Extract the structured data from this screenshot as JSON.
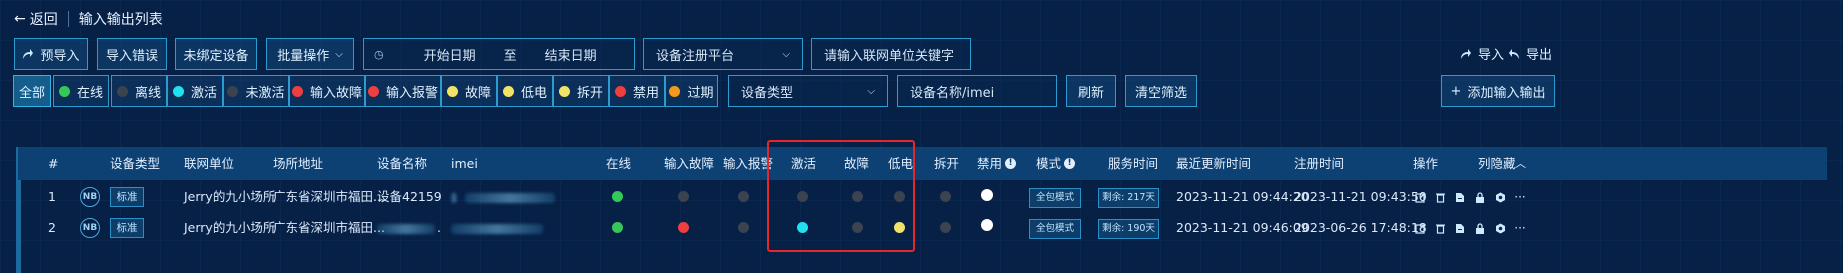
{
  "header": {
    "back_label": "返回",
    "title": "输入输出列表"
  },
  "toolbar": {
    "pre_import": "预导入",
    "import_error": "导入错误",
    "unbound_device": "未绑定设备",
    "batch_ops": "批量操作",
    "start_date": "开始日期",
    "date_to": "至",
    "end_date": "结束日期",
    "platform_select": "设备注册平台",
    "keyword_placeholder": "请输入联网单位关键字",
    "import": "导入",
    "export": "导出"
  },
  "filters": [
    {
      "label": "全部",
      "dot": null,
      "active": true
    },
    {
      "label": "在线",
      "dot": "#35c759"
    },
    {
      "label": "离线",
      "dot": "#3b4350"
    },
    {
      "label": "激活",
      "dot": "#22e0ee"
    },
    {
      "label": "未激活",
      "dot": "#3b4350"
    },
    {
      "label": "输入故障",
      "dot": "#ef3e3e"
    },
    {
      "label": "输入报警",
      "dot": "#ef3e3e"
    },
    {
      "label": "故障",
      "dot": "#f1e36a"
    },
    {
      "label": "低电",
      "dot": "#f1e36a"
    },
    {
      "label": "拆开",
      "dot": "#f1e36a"
    },
    {
      "label": "禁用",
      "dot": "#ef3e3e"
    },
    {
      "label": "过期",
      "dot": "#f39a1e"
    }
  ],
  "filter_bar": {
    "device_type_select": "设备类型",
    "device_name_placeholder": "设备名称/imei",
    "refresh": "刷新",
    "clear_filter": "清空筛选",
    "add_io": "添加输入输出"
  },
  "table": {
    "headers": {
      "index": "#",
      "device_type": "设备类型",
      "unit": "联网单位",
      "address": "场所地址",
      "device_name": "设备名称",
      "imei": "imei",
      "online": "在线",
      "input_fault": "输入故障",
      "input_alarm": "输入报警",
      "activated": "激活",
      "fault": "故障",
      "low_battery": "低电",
      "tamper": "拆开",
      "disabled": "禁用",
      "mode": "模式",
      "service_time": "服务时间",
      "last_update": "最近更新时间",
      "register_time": "注册时间",
      "actions": "操作",
      "hide_cols": "列隐藏"
    },
    "rows": [
      {
        "index": "1",
        "type_icon": "NB",
        "type_tag": "标准",
        "unit": "Jerry的九小场所",
        "address": "广东省深圳市福田...",
        "device_name": "设备42159",
        "online": "#35c759",
        "input_fault": "#3b4350",
        "input_alarm": "#3b4350",
        "activated": "#3b4350",
        "fault": "#3b4350",
        "low_battery": "#3b4350",
        "tamper": "#3b4350",
        "disabled": "#ffffff",
        "mode": "全包模式",
        "service": "剩余: 217天",
        "last_update": "2023-11-21 09:44:20",
        "register_time": "2023-11-21 09:43:50"
      },
      {
        "index": "2",
        "type_icon": "NB",
        "type_tag": "标准",
        "unit": "Jerry的九小场所",
        "address": "广东省深圳市福田...",
        "device_name": ".",
        "online": "#35c759",
        "input_fault": "#ef3e3e",
        "input_alarm": "#3b4350",
        "activated": "#22e0ee",
        "fault": "#3b4350",
        "low_battery": "#f1e36a",
        "tamper": "#3b4350",
        "disabled": "#ffffff",
        "mode": "全包模式",
        "service": "剩余: 190天",
        "last_update": "2023-11-21 09:46:09",
        "register_time": "2023-06-26 17:48:18"
      }
    ]
  },
  "colors": {
    "accent": "#2c9bd0",
    "header_bg": "#0d4173",
    "highlight": "#e8262a"
  }
}
